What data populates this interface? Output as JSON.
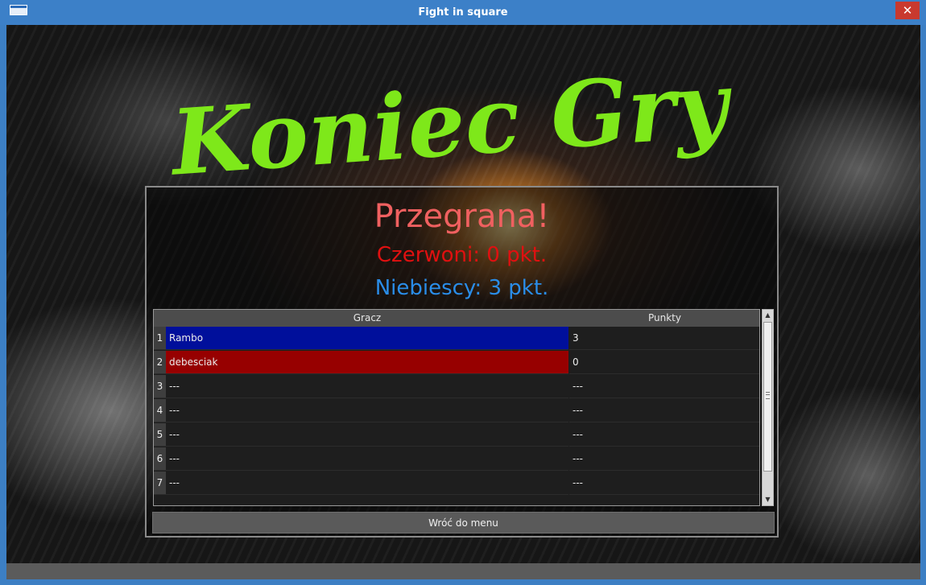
{
  "window": {
    "title": "Fight in square",
    "close_symbol": "✕"
  },
  "logo": {
    "text": "Koniec Gry",
    "color": "#7ee81a"
  },
  "result": {
    "headline": "Przegrana!",
    "red_team": "Czerwoni: 0 pkt.",
    "blue_team": "Niebiescy: 3 pkt."
  },
  "table": {
    "columns": [
      "Gracz",
      "Punkty"
    ],
    "rows": [
      {
        "num": "1",
        "name": "Rambo",
        "points": "3",
        "highlight": "#000f9b"
      },
      {
        "num": "2",
        "name": "debesciak",
        "points": "0",
        "highlight": "#970000"
      },
      {
        "num": "3",
        "name": "---",
        "points": "---",
        "highlight": ""
      },
      {
        "num": "4",
        "name": "---",
        "points": "---",
        "highlight": ""
      },
      {
        "num": "5",
        "name": "---",
        "points": "---",
        "highlight": ""
      },
      {
        "num": "6",
        "name": "---",
        "points": "---",
        "highlight": ""
      },
      {
        "num": "7",
        "name": "---",
        "points": "---",
        "highlight": ""
      }
    ]
  },
  "back_button": {
    "label": "Wróć do menu"
  },
  "colors": {
    "title_bar": "#3c80c8",
    "lose": "#f06060",
    "red": "#e01010",
    "blue": "#2a8de8"
  }
}
